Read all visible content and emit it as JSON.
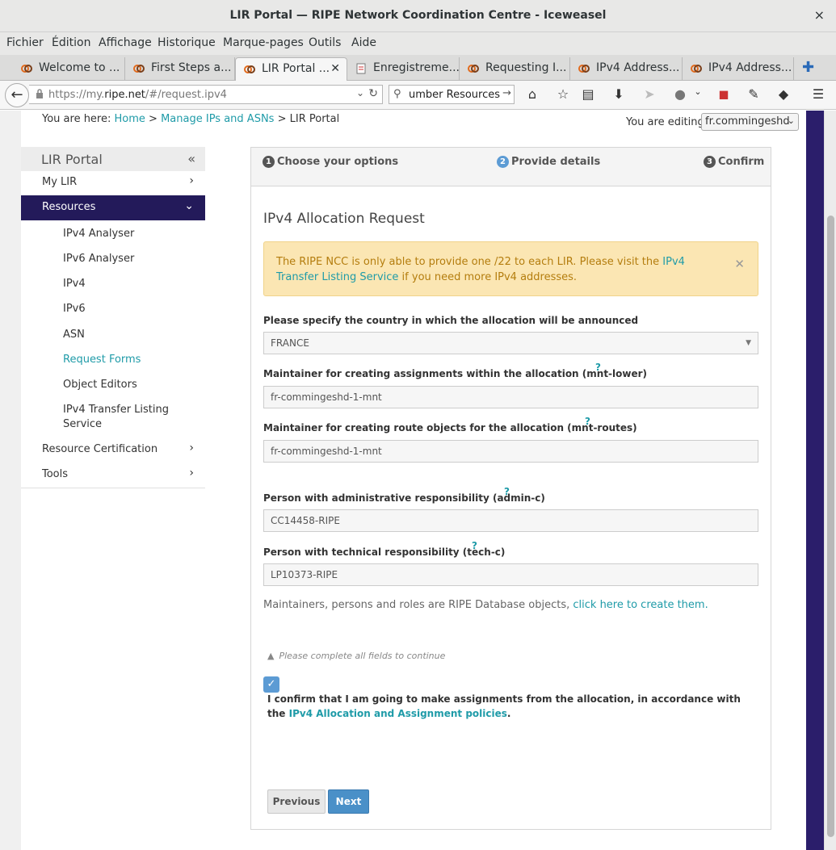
{
  "window": {
    "title": "LIR Portal — RIPE Network Coordination Centre - Iceweasel",
    "close": "×"
  },
  "menu": [
    "Fichier",
    "Édition",
    "Affichage",
    "Historique",
    "Marque-pages",
    "Outils",
    "Aide"
  ],
  "tabs": [
    {
      "label": "Welcome to ...",
      "active": false
    },
    {
      "label": "First Steps a...",
      "active": false
    },
    {
      "label": "LIR Portal ...",
      "active": true
    },
    {
      "label": "Enregistreme...",
      "active": false
    },
    {
      "label": "Requesting I...",
      "active": false
    },
    {
      "label": "IPv4 Address...",
      "active": false
    },
    {
      "label": "IPv4 Address...",
      "active": false
    }
  ],
  "nav": {
    "url_prefix": "https://my.",
    "url_domain": "ripe.net",
    "url_path": "/#/request.ipv4",
    "search_text": "umber Resources"
  },
  "breadcrumb": {
    "prefix": "You are here:",
    "home": "Home",
    "sep": ">",
    "manage": "Manage IPs and ASNs",
    "current": "LIR Portal"
  },
  "editing": {
    "label": "You are editing",
    "value": "fr.commingeshd"
  },
  "sidebar": {
    "title": "LIR Portal",
    "items": [
      {
        "label": "My LIR"
      },
      {
        "label": "Resources"
      },
      {
        "label": "Resource Certification"
      },
      {
        "label": "Tools"
      }
    ],
    "subitems": [
      "IPv4 Analyser",
      "IPv6 Analyser",
      "IPv4",
      "IPv6",
      "ASN",
      "Request Forms",
      "Object Editors",
      "IPv4 Transfer Listing",
      "Service"
    ]
  },
  "steps": [
    {
      "num": "1",
      "label": "Choose your options"
    },
    {
      "num": "2",
      "label": "Provide details"
    },
    {
      "num": "3",
      "label": "Confirm"
    }
  ],
  "form": {
    "heading": "IPv4 Allocation Request",
    "alert_before": "The RIPE NCC is only able to provide one /22 to each LIR. Please visit the ",
    "alert_link": "IPv4 Transfer Listing Service",
    "alert_after": " if you need more IPv4 addresses.",
    "country_label": "Please specify the country in which the allocation will be announced",
    "country_value": "FRANCE",
    "mnt_lower_label": "Maintainer for creating assignments within the allocation (mnt-lower)",
    "mnt_lower_value": "fr-commingeshd-1-mnt",
    "mnt_routes_label": "Maintainer for creating route objects for the allocation (mnt-routes)",
    "mnt_routes_value": "fr-commingeshd-1-mnt",
    "admin_label": "Person with administrative responsibility (admin-c)",
    "admin_value": "CC14458-RIPE",
    "tech_label": "Person with technical responsibility (tech-c)",
    "tech_value": "LP10373-RIPE",
    "help": "?",
    "note_text": "Maintainers, persons and roles are RIPE Database objects, ",
    "note_link": "click here to create them.",
    "warning": "Please complete all fields to continue",
    "confirm_text": "I confirm that I am going to make assignments from the allocation, in accordance with the ",
    "confirm_link": "IPv4 Allocation and Assignment policies",
    "confirm_end": ".",
    "confirmed": true,
    "prev_label": "Previous",
    "next_label": "Next"
  },
  "colors": {
    "accent": "#1f9ba8",
    "nav_active": "#231a5a",
    "button_primary": "#4a90c8",
    "alert_bg": "#fbe6b3"
  }
}
